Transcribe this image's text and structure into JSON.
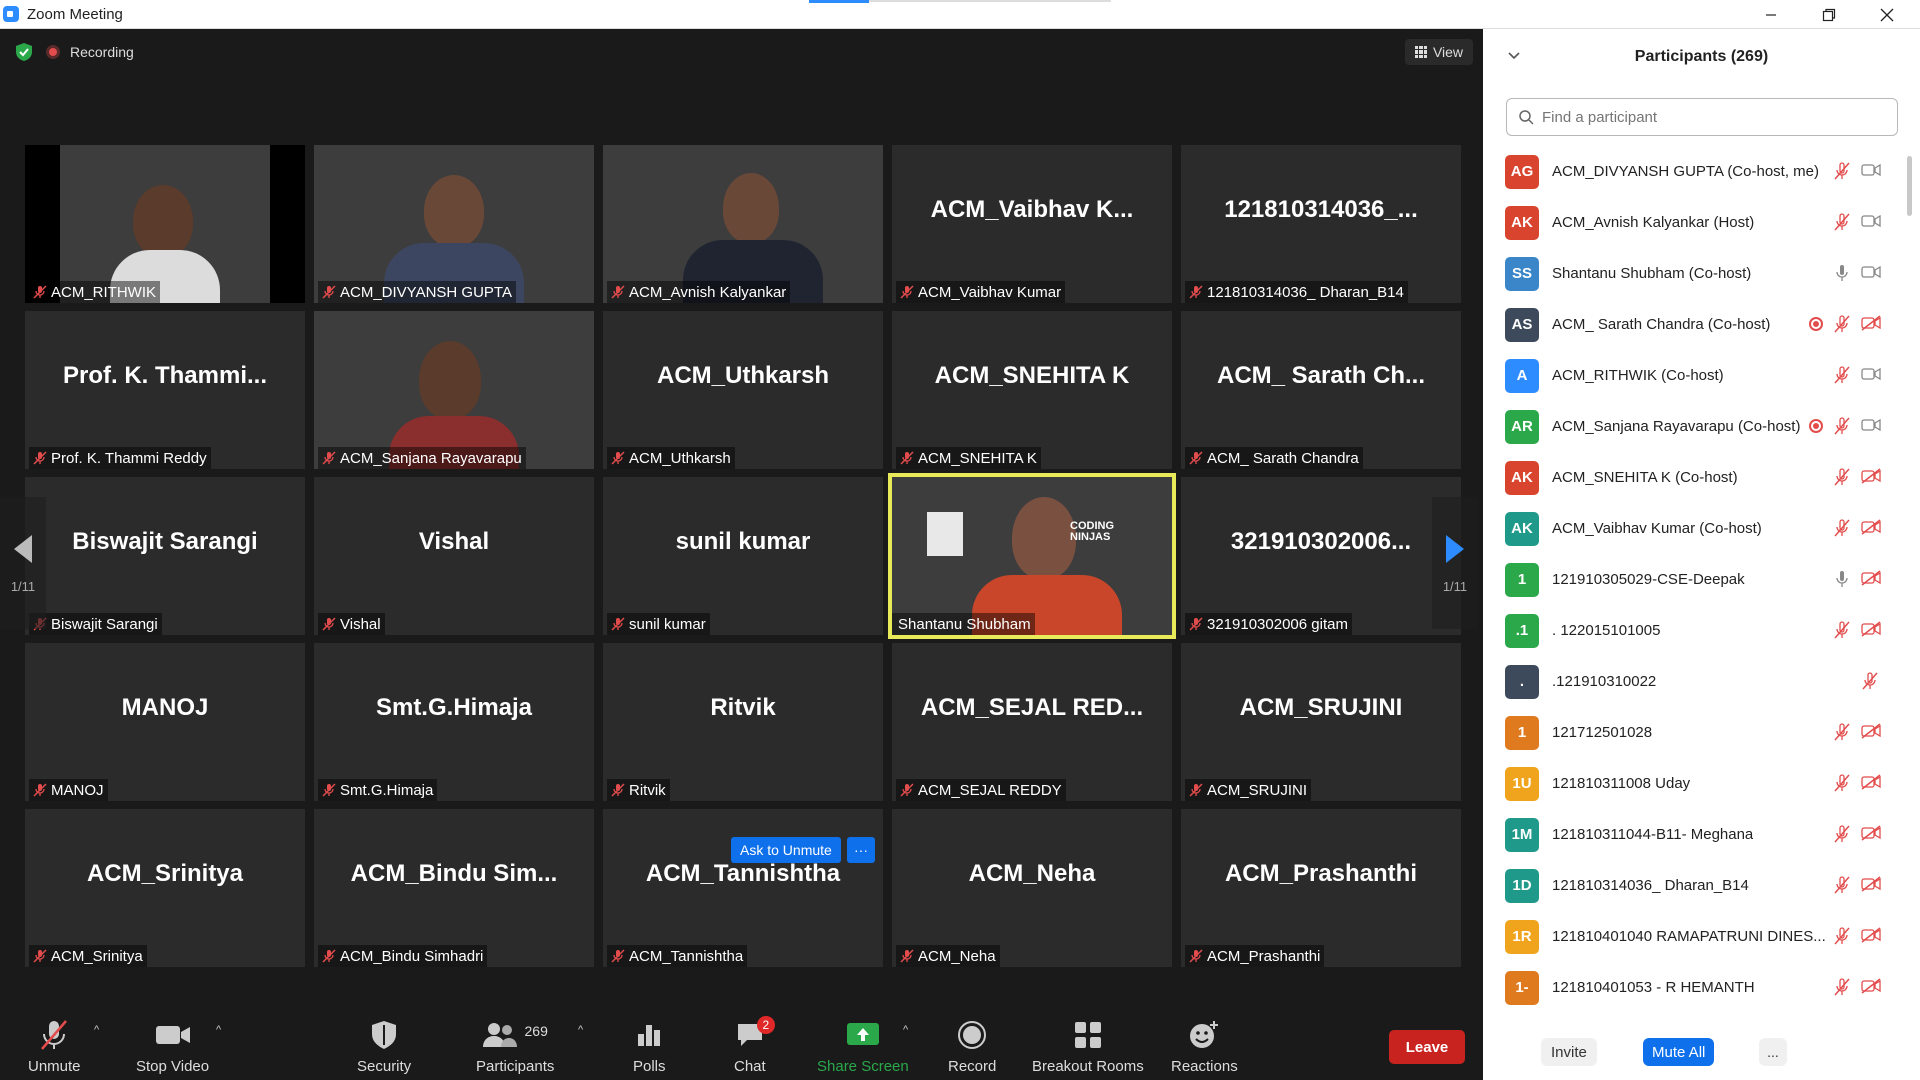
{
  "window": {
    "title": "Zoom Meeting"
  },
  "meeting": {
    "recording_label": "Recording",
    "view_label": "View",
    "page_indicator": "1/11",
    "ask_to_unmute": "Ask to Unmute",
    "more": "···",
    "tiles": [
      {
        "big": "",
        "name": "ACM_RITHWIK"
      },
      {
        "big": "",
        "name": "ACM_DIVYANSH GUPTA"
      },
      {
        "big": "",
        "name": "ACM_Avnish Kalyankar"
      },
      {
        "big": "ACM_Vaibhav  K...",
        "name": "ACM_Vaibhav Kumar"
      },
      {
        "big": "121810314036_...",
        "name": "121810314036_ Dharan_B14"
      },
      {
        "big": "Prof.  K.  Thammi...",
        "name": "Prof. K. Thammi Reddy"
      },
      {
        "big": "",
        "name": "ACM_Sanjana Rayavarapu"
      },
      {
        "big": "ACM_Uthkarsh",
        "name": "ACM_Uthkarsh"
      },
      {
        "big": "ACM_SNEHITA K",
        "name": "ACM_SNEHITA K"
      },
      {
        "big": "ACM_  Sarath  Ch...",
        "name": "ACM_ Sarath Chandra"
      },
      {
        "big": "Biswajit Sarangi",
        "name": "Biswajit Sarangi"
      },
      {
        "big": "Vishal",
        "name": "Vishal"
      },
      {
        "big": "sunil kumar",
        "name": "sunil kumar"
      },
      {
        "big": "",
        "name": "Shantanu Shubham",
        "banner": "CODING NINJAS"
      },
      {
        "big": "321910302006...",
        "name": "321910302006 gitam"
      },
      {
        "big": "MANOJ",
        "name": "MANOJ"
      },
      {
        "big": "Smt.G.Himaja",
        "name": "Smt.G.Himaja"
      },
      {
        "big": "Ritvik",
        "name": "Ritvik"
      },
      {
        "big": "ACM_SEJAL  RED...",
        "name": "ACM_SEJAL REDDY"
      },
      {
        "big": "ACM_SRUJINI",
        "name": "ACM_SRUJINI"
      },
      {
        "big": "ACM_Srinitya",
        "name": "ACM_Srinitya"
      },
      {
        "big": "ACM_Bindu  Sim...",
        "name": "ACM_Bindu Simhadri"
      },
      {
        "big": "ACM_Tannishtha",
        "name": "ACM_Tannishtha"
      },
      {
        "big": "ACM_Neha",
        "name": "ACM_Neha"
      },
      {
        "big": "ACM_Prashanthi",
        "name": "ACM_Prashanthi"
      }
    ]
  },
  "toolbar": {
    "unmute": "Unmute",
    "stop_video": "Stop Video",
    "security": "Security",
    "participants": "Participants",
    "participants_count": "269",
    "polls": "Polls",
    "chat": "Chat",
    "chat_badge": "2",
    "share_screen": "Share Screen",
    "record": "Record",
    "breakout_rooms": "Breakout Rooms",
    "reactions": "Reactions",
    "leave": "Leave"
  },
  "panel": {
    "title": "Participants (269)",
    "search_placeholder": "Find a participant",
    "invite": "Invite",
    "mute_all": "Mute All",
    "more": "...",
    "participants": [
      {
        "initials": "AG",
        "color": "#d9442e",
        "name": "ACM_DIVYANSH GUPTA (Co-host, me)",
        "rec": false,
        "mic": "muted",
        "cam": "on"
      },
      {
        "initials": "AK",
        "color": "#d9442e",
        "name": "ACM_Avnish Kalyankar (Host)",
        "rec": false,
        "mic": "muted",
        "cam": "on"
      },
      {
        "initials": "SS",
        "color": "#3a86c8",
        "name": "Shantanu Shubham (Co-host)",
        "rec": false,
        "mic": "on",
        "cam": "on"
      },
      {
        "initials": "AS",
        "color": "#3d4a5c",
        "name": "ACM_ Sarath Chandra (Co-host)",
        "rec": true,
        "mic": "muted",
        "cam": "off"
      },
      {
        "initials": "A",
        "color": "#2d8cff",
        "name": "ACM_RITHWIK (Co-host)",
        "rec": false,
        "mic": "muted",
        "cam": "on"
      },
      {
        "initials": "AR",
        "color": "#2aa84a",
        "name": "ACM_Sanjana Rayavarapu (Co-host)",
        "rec": true,
        "mic": "muted",
        "cam": "on"
      },
      {
        "initials": "AK",
        "color": "#d9442e",
        "name": "ACM_SNEHITA K (Co-host)",
        "rec": false,
        "mic": "muted",
        "cam": "off"
      },
      {
        "initials": "AK",
        "color": "#1f9a8a",
        "name": "ACM_Vaibhav Kumar (Co-host)",
        "rec": false,
        "mic": "muted",
        "cam": "off"
      },
      {
        "initials": "1",
        "color": "#2aa84a",
        "name": "121910305029-CSE-Deepak",
        "rec": false,
        "mic": "on",
        "cam": "off"
      },
      {
        "initials": ".1",
        "color": "#2aa84a",
        "name": ". 122015101005",
        "rec": false,
        "mic": "muted",
        "cam": "off"
      },
      {
        "initials": ".",
        "color": "#3d4a5c",
        "name": ".121910310022",
        "rec": false,
        "mic": "none",
        "cam": "muted-only"
      },
      {
        "initials": "1",
        "color": "#e07a1f",
        "name": "121712501028",
        "rec": false,
        "mic": "muted",
        "cam": "off"
      },
      {
        "initials": "1U",
        "color": "#f0a31c",
        "name": "121810311008 Uday",
        "rec": false,
        "mic": "muted",
        "cam": "off"
      },
      {
        "initials": "1M",
        "color": "#1f9a8a",
        "name": "121810311044-B11- Meghana",
        "rec": false,
        "mic": "muted",
        "cam": "off"
      },
      {
        "initials": "1D",
        "color": "#1f9a8a",
        "name": "121810314036_ Dharan_B14",
        "rec": false,
        "mic": "muted",
        "cam": "off"
      },
      {
        "initials": "1R",
        "color": "#f0a31c",
        "name": "121810401040 RAMAPATRUNI DINES...",
        "rec": false,
        "mic": "muted",
        "cam": "off"
      },
      {
        "initials": "1-",
        "color": "#e07a1f",
        "name": "121810401053 - R HEMANTH",
        "rec": false,
        "mic": "muted",
        "cam": "off"
      }
    ]
  }
}
